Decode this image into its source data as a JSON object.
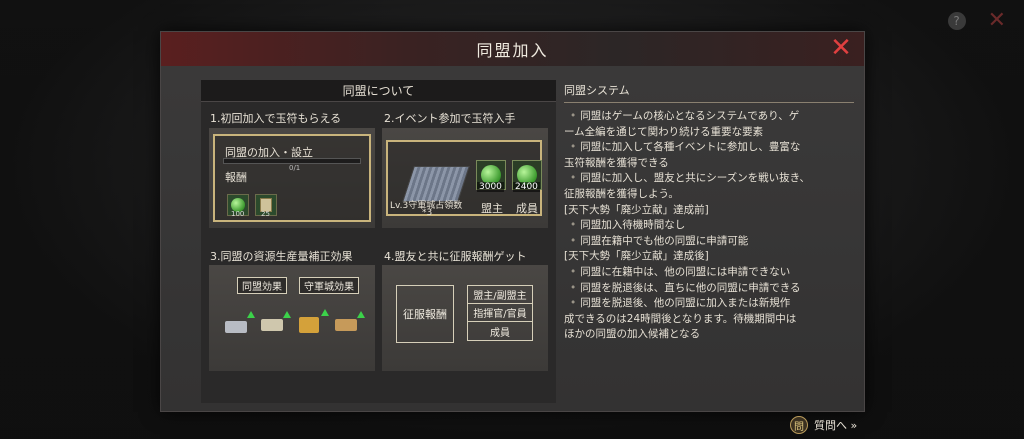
{
  "dialog": {
    "title": "同盟加入",
    "close_symbol": "✕"
  },
  "background": {
    "help_symbol": "?",
    "close_symbol": "✕"
  },
  "left": {
    "header": "同盟について",
    "s1": {
      "label": "1.初回加入で玉符もらえる",
      "join_text": "同盟の加入・設立",
      "progress": "0/1",
      "progress_fraction": 0,
      "reward_label": "報酬",
      "rewards": [
        {
          "icon": "jade-gem-icon",
          "count": "100"
        },
        {
          "icon": "scroll-icon",
          "count": "25"
        }
      ]
    },
    "s2": {
      "label": "2.イベント参加で玉符入手",
      "fortress_caption_1": "Lv.3守軍城占領数",
      "fortress_caption_2": "*3",
      "rewards": [
        {
          "value": "3000",
          "caption": "盟主"
        },
        {
          "value": "2400",
          "caption": "成員"
        }
      ]
    },
    "s3": {
      "label": "3.同盟の資源生産量補正効果",
      "tag1": "同盟効果",
      "tag2": "守軍城効果"
    },
    "s4": {
      "label": "4.盟友と共に征服報酬ゲット",
      "box": "征服報酬",
      "roles": [
        "盟主/副盟主",
        "指揮官/官員",
        "成員"
      ]
    }
  },
  "right": {
    "title": "同盟システム",
    "lines": [
      {
        "bullet": true,
        "text": "同盟はゲームの核心となるシステムであり、ゲ"
      },
      {
        "bullet": false,
        "text": "ーム全編を通じて関わり続ける重要な要素"
      },
      {
        "bullet": true,
        "text": "同盟に加入して各種イベントに参加し、豊富な"
      },
      {
        "bullet": false,
        "text": "玉符報酬を獲得できる"
      },
      {
        "bullet": true,
        "text": "同盟に加入し、盟友と共にシーズンを戦い抜き、"
      },
      {
        "bullet": false,
        "text": "征服報酬を獲得しよう。"
      },
      {
        "bullet": false,
        "text": "[天下大勢「廃少立献」達成前]"
      },
      {
        "bullet": true,
        "text": "同盟加入待機時間なし"
      },
      {
        "bullet": true,
        "text": "同盟在籍中でも他の同盟に申請可能"
      },
      {
        "bullet": false,
        "text": "[天下大勢「廃少立献」達成後]"
      },
      {
        "bullet": true,
        "text": "同盟に在籍中は、他の同盟には申請できない"
      },
      {
        "bullet": true,
        "text": "同盟を脱退後は、直ちに他の同盟に申請できる"
      },
      {
        "bullet": true,
        "text": "同盟を脱退後、他の同盟に加入または新規作"
      },
      {
        "bullet": false,
        "text": "成できるのは24時間後となります。待機期間中は"
      },
      {
        "bullet": false,
        "text": "ほかの同盟の加入候補となる"
      }
    ]
  },
  "footer": {
    "icon": "book-icon",
    "icon_glyph": "問",
    "label": "質問へ »"
  }
}
